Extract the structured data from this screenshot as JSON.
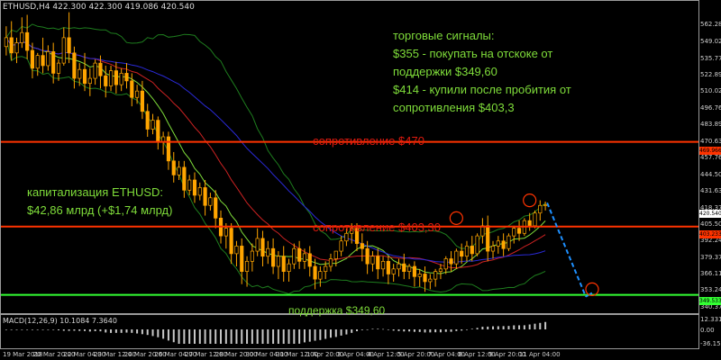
{
  "header": {
    "symbol_line": "ETHUSD,H4  422.300 422.300 419.086 420.540"
  },
  "annotations": {
    "signals": [
      "торговые сигналы:",
      "$355 - покупать на отскоке от",
      "поддержки $349,60",
      "$414 - купили после пробития от",
      "сопротивления $403,3"
    ],
    "cap": [
      "капитализация ETHUSD:",
      "$42,86 млрд (+$1,74 млрд)"
    ]
  },
  "levels": {
    "res470": {
      "label": "сопротивление $470",
      "value": 470,
      "price_tag": "469.966"
    },
    "res403": {
      "label": "сопротивление $403,30",
      "value": 403.3,
      "price_tag": "403.233"
    },
    "sup349": {
      "label": "поддержка $349,60",
      "value": 349.6,
      "price_tag": "349.533"
    }
  },
  "last_price_tag": "420.540",
  "macd": {
    "header": "MACD(12,26,9) 10.1084 7.3640",
    "ticks": [
      "12.3313",
      "0.00",
      "-36.1567"
    ]
  },
  "colors": {
    "background": "#000000",
    "bull_candle": "#000000",
    "bear_candle": "#ffa500",
    "candle_outline": "#ffa500",
    "resistance": "#ff3300",
    "support": "#33ff33",
    "annotation_text": "#7fdd3a",
    "forecast": "#1e90ff"
  },
  "chart_data": {
    "type": "candlestick",
    "symbol": "ETHUSD",
    "timeframe": "H4",
    "ylim": [
      338,
      576
    ],
    "y_ticks": [
      "562.280",
      "549.025",
      "535.770",
      "522.895",
      "510.020",
      "496.765",
      "483.890",
      "470.635",
      "457.760",
      "444.505",
      "431.630",
      "418.375",
      "405.500",
      "392.245",
      "379.370",
      "366.115",
      "353.240",
      "340.375"
    ],
    "x_ticks": [
      "19 Mar 2018",
      "20 Mar 20:00",
      "22 Mar 04:00",
      "23 Mar 12:00",
      "24 Mar 20:00",
      "26 Mar 04:00",
      "27 Mar 12:00",
      "28 Mar 20:00",
      "30 Mar 04:00",
      "31 Mar 12:00",
      "1 Apr 20:00",
      "3 Apr 04:00",
      "4 Apr 12:00",
      "5 Apr 20:00",
      "7 Apr 04:00",
      "8 Apr 12:00",
      "9 Apr 20:00",
      "11 Apr 04:00"
    ],
    "candles": [
      {
        "o": 545,
        "h": 561,
        "c": 552,
        "l": 538
      },
      {
        "o": 552,
        "h": 565,
        "c": 540,
        "l": 534
      },
      {
        "o": 540,
        "h": 552,
        "c": 548,
        "l": 532
      },
      {
        "o": 548,
        "h": 568,
        "c": 556,
        "l": 544
      },
      {
        "o": 556,
        "h": 570,
        "c": 542,
        "l": 535
      },
      {
        "o": 542,
        "h": 548,
        "c": 528,
        "l": 520
      },
      {
        "o": 528,
        "h": 540,
        "c": 538,
        "l": 522
      },
      {
        "o": 538,
        "h": 552,
        "c": 530,
        "l": 524
      },
      {
        "o": 530,
        "h": 546,
        "c": 541,
        "l": 526
      },
      {
        "o": 541,
        "h": 548,
        "c": 524,
        "l": 516
      },
      {
        "o": 524,
        "h": 535,
        "c": 532,
        "l": 518
      },
      {
        "o": 532,
        "h": 560,
        "c": 552,
        "l": 530
      },
      {
        "o": 552,
        "h": 572,
        "c": 540,
        "l": 532
      },
      {
        "o": 540,
        "h": 545,
        "c": 520,
        "l": 512
      },
      {
        "o": 520,
        "h": 532,
        "c": 527,
        "l": 514
      },
      {
        "o": 527,
        "h": 540,
        "c": 516,
        "l": 510
      },
      {
        "o": 516,
        "h": 528,
        "c": 520,
        "l": 506
      },
      {
        "o": 520,
        "h": 535,
        "c": 532,
        "l": 515
      },
      {
        "o": 532,
        "h": 538,
        "c": 522,
        "l": 512
      },
      {
        "o": 522,
        "h": 530,
        "c": 514,
        "l": 505
      },
      {
        "o": 514,
        "h": 530,
        "c": 526,
        "l": 510
      },
      {
        "o": 526,
        "h": 533,
        "c": 515,
        "l": 508
      },
      {
        "o": 515,
        "h": 528,
        "c": 524,
        "l": 510
      },
      {
        "o": 524,
        "h": 532,
        "c": 518,
        "l": 512
      },
      {
        "o": 518,
        "h": 524,
        "c": 505,
        "l": 498
      },
      {
        "o": 505,
        "h": 515,
        "c": 510,
        "l": 500
      },
      {
        "o": 510,
        "h": 518,
        "c": 494,
        "l": 488
      },
      {
        "o": 494,
        "h": 500,
        "c": 480,
        "l": 474
      },
      {
        "o": 480,
        "h": 492,
        "c": 487,
        "l": 476
      },
      {
        "o": 487,
        "h": 490,
        "c": 470,
        "l": 464
      },
      {
        "o": 470,
        "h": 478,
        "c": 474,
        "l": 460
      },
      {
        "o": 474,
        "h": 478,
        "c": 455,
        "l": 448
      },
      {
        "o": 455,
        "h": 462,
        "c": 444,
        "l": 438
      },
      {
        "o": 444,
        "h": 455,
        "c": 450,
        "l": 440
      },
      {
        "o": 450,
        "h": 455,
        "c": 432,
        "l": 426
      },
      {
        "o": 432,
        "h": 444,
        "c": 440,
        "l": 428
      },
      {
        "o": 440,
        "h": 446,
        "c": 428,
        "l": 422
      },
      {
        "o": 428,
        "h": 438,
        "c": 434,
        "l": 424
      },
      {
        "o": 434,
        "h": 440,
        "c": 420,
        "l": 412
      },
      {
        "o": 420,
        "h": 430,
        "c": 426,
        "l": 416
      },
      {
        "o": 426,
        "h": 432,
        "c": 410,
        "l": 402
      },
      {
        "o": 410,
        "h": 416,
        "c": 396,
        "l": 390
      },
      {
        "o": 396,
        "h": 406,
        "c": 402,
        "l": 386
      },
      {
        "o": 402,
        "h": 406,
        "c": 382,
        "l": 374
      },
      {
        "o": 382,
        "h": 392,
        "c": 388,
        "l": 372
      },
      {
        "o": 388,
        "h": 394,
        "c": 368,
        "l": 358
      },
      {
        "o": 368,
        "h": 380,
        "c": 376,
        "l": 356
      },
      {
        "o": 376,
        "h": 390,
        "c": 384,
        "l": 368
      },
      {
        "o": 384,
        "h": 402,
        "c": 394,
        "l": 380
      },
      {
        "o": 394,
        "h": 400,
        "c": 380,
        "l": 372
      },
      {
        "o": 380,
        "h": 392,
        "c": 386,
        "l": 374
      },
      {
        "o": 386,
        "h": 394,
        "c": 372,
        "l": 366
      },
      {
        "o": 372,
        "h": 384,
        "c": 380,
        "l": 362
      },
      {
        "o": 380,
        "h": 388,
        "c": 368,
        "l": 360
      },
      {
        "o": 368,
        "h": 378,
        "c": 374,
        "l": 360
      },
      {
        "o": 374,
        "h": 390,
        "c": 386,
        "l": 370
      },
      {
        "o": 386,
        "h": 392,
        "c": 376,
        "l": 370
      },
      {
        "o": 376,
        "h": 386,
        "c": 382,
        "l": 370
      },
      {
        "o": 382,
        "h": 388,
        "c": 372,
        "l": 364
      },
      {
        "o": 372,
        "h": 378,
        "c": 362,
        "l": 354
      },
      {
        "o": 362,
        "h": 372,
        "c": 368,
        "l": 356
      },
      {
        "o": 368,
        "h": 376,
        "c": 372,
        "l": 362
      },
      {
        "o": 372,
        "h": 382,
        "c": 378,
        "l": 368
      },
      {
        "o": 378,
        "h": 384,
        "c": 384,
        "l": 372
      },
      {
        "o": 384,
        "h": 396,
        "c": 392,
        "l": 380
      },
      {
        "o": 392,
        "h": 402,
        "c": 398,
        "l": 388
      },
      {
        "o": 398,
        "h": 406,
        "c": 402,
        "l": 390
      },
      {
        "o": 402,
        "h": 406,
        "c": 390,
        "l": 384
      },
      {
        "o": 390,
        "h": 398,
        "c": 386,
        "l": 376
      },
      {
        "o": 386,
        "h": 392,
        "c": 374,
        "l": 366
      },
      {
        "o": 374,
        "h": 384,
        "c": 380,
        "l": 368
      },
      {
        "o": 380,
        "h": 386,
        "c": 370,
        "l": 362
      },
      {
        "o": 370,
        "h": 380,
        "c": 376,
        "l": 364
      },
      {
        "o": 376,
        "h": 380,
        "c": 366,
        "l": 358
      },
      {
        "o": 366,
        "h": 374,
        "c": 370,
        "l": 360
      },
      {
        "o": 370,
        "h": 378,
        "c": 374,
        "l": 364
      },
      {
        "o": 374,
        "h": 382,
        "c": 368,
        "l": 362
      },
      {
        "o": 368,
        "h": 374,
        "c": 372,
        "l": 362
      },
      {
        "o": 372,
        "h": 376,
        "c": 364,
        "l": 356
      },
      {
        "o": 364,
        "h": 370,
        "c": 366,
        "l": 356
      },
      {
        "o": 366,
        "h": 372,
        "c": 360,
        "l": 352
      },
      {
        "o": 360,
        "h": 366,
        "c": 362,
        "l": 354
      },
      {
        "o": 362,
        "h": 370,
        "c": 368,
        "l": 356
      },
      {
        "o": 368,
        "h": 374,
        "c": 370,
        "l": 362
      },
      {
        "o": 370,
        "h": 380,
        "c": 378,
        "l": 366
      },
      {
        "o": 378,
        "h": 384,
        "c": 374,
        "l": 368
      },
      {
        "o": 374,
        "h": 386,
        "c": 384,
        "l": 370
      },
      {
        "o": 384,
        "h": 390,
        "c": 380,
        "l": 374
      },
      {
        "o": 380,
        "h": 392,
        "c": 388,
        "l": 376
      },
      {
        "o": 388,
        "h": 396,
        "c": 382,
        "l": 376
      },
      {
        "o": 382,
        "h": 398,
        "c": 396,
        "l": 380
      },
      {
        "o": 396,
        "h": 410,
        "c": 404,
        "l": 390
      },
      {
        "o": 404,
        "h": 412,
        "c": 384,
        "l": 376
      },
      {
        "o": 384,
        "h": 392,
        "c": 388,
        "l": 378
      },
      {
        "o": 388,
        "h": 396,
        "c": 392,
        "l": 382
      },
      {
        "o": 392,
        "h": 398,
        "c": 386,
        "l": 380
      },
      {
        "o": 386,
        "h": 398,
        "c": 396,
        "l": 384
      },
      {
        "o": 396,
        "h": 404,
        "c": 402,
        "l": 390
      },
      {
        "o": 402,
        "h": 408,
        "c": 398,
        "l": 392
      },
      {
        "o": 398,
        "h": 410,
        "c": 408,
        "l": 396
      },
      {
        "o": 408,
        "h": 414,
        "c": 404,
        "l": 400
      },
      {
        "o": 404,
        "h": 416,
        "c": 414,
        "l": 402
      },
      {
        "o": 414,
        "h": 424,
        "c": 420,
        "l": 408
      },
      {
        "o": 420,
        "h": 423,
        "c": 420.5,
        "l": 416
      }
    ],
    "indicators": [
      {
        "name": "bollinger_upper",
        "color": "#1e7d1e"
      },
      {
        "name": "bollinger_lower",
        "color": "#1e7d1e"
      },
      {
        "name": "ma_fast",
        "color": "#7fdd3a"
      },
      {
        "name": "ma_mid",
        "color": "#cc2222"
      },
      {
        "name": "ma_slow",
        "color": "#2a2ad8"
      }
    ],
    "forecast": {
      "from_price": 422,
      "to_price": 349.6,
      "style": "dashed",
      "color": "#1e90ff"
    },
    "circles": [
      {
        "price": 410,
        "color": "#ff3300"
      },
      {
        "price": 424,
        "color": "#ff3300"
      },
      {
        "price": 354,
        "color": "#ff3300"
      }
    ]
  }
}
